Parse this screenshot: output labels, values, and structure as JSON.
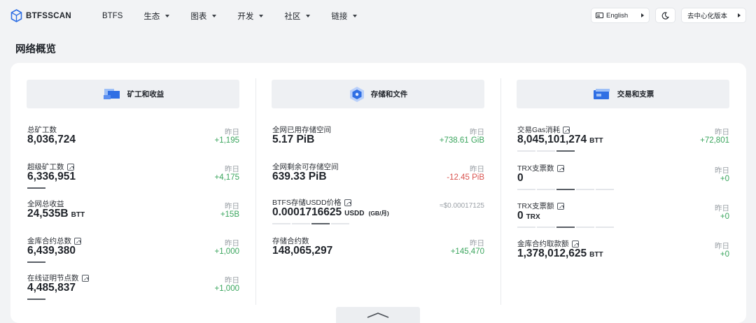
{
  "brand": {
    "name": "BTFSSCAN"
  },
  "nav": [
    {
      "label": "BTFS",
      "has_menu": false
    },
    {
      "label": "生态",
      "has_menu": true
    },
    {
      "label": "图表",
      "has_menu": true
    },
    {
      "label": "开发",
      "has_menu": true
    },
    {
      "label": "社区",
      "has_menu": true
    },
    {
      "label": "链接",
      "has_menu": true
    }
  ],
  "toolbar": {
    "language_label": "English",
    "decentralized_label": "去中心化版本"
  },
  "page_title": "网络概览",
  "yesterday_label": "昨日",
  "sections": {
    "mining": {
      "title": "矿工和收益",
      "stats": [
        {
          "label": "总矿工数",
          "value": "8,036,724",
          "delta": "+1,195"
        },
        {
          "label": "超级矿工数",
          "value": "6,336,951",
          "delta": "+4,175"
        },
        {
          "label": "全网总收益",
          "value": "24,535B",
          "unit": "BTT",
          "delta": "+15B"
        },
        {
          "label": "金库合约总数",
          "value": "6,439,380",
          "delta": "+1,000"
        },
        {
          "label": "在线证明节点数",
          "value": "4,485,837",
          "delta": "+1,000"
        }
      ]
    },
    "storage": {
      "title": "存储和文件",
      "stats": [
        {
          "label": "全网已用存储空间",
          "value": "5.17 PiB",
          "delta": "+738.61 GiB"
        },
        {
          "label": "全网剩余可存储空间",
          "value": "639.33 PiB",
          "delta": "-12.45 PiB"
        },
        {
          "label": "BTFS存储USDD价格",
          "value": "0.0001716625",
          "unit": "USDD",
          "subunit": "(GB/月)",
          "approx": "≈$0.00017125"
        },
        {
          "label": "存储合约数",
          "value": "148,065,297",
          "delta": "+145,470"
        }
      ]
    },
    "trading": {
      "title": "交易和支票",
      "stats": [
        {
          "label": "交易Gas消耗",
          "value": "8,045,101,274",
          "unit": "BTT",
          "delta": "+72,801"
        },
        {
          "label": "TRX支票数",
          "value": "0",
          "delta": "+0"
        },
        {
          "label": "TRX支票额",
          "value": "0",
          "unit": "TRX",
          "delta": "+0"
        },
        {
          "label": "金库合约取款额",
          "value": "1,378,012,625",
          "unit": "BTT",
          "delta": "+0"
        }
      ]
    }
  },
  "colors": {
    "positive": "#3aa55d",
    "negative": "#d9534f",
    "accent": "#2f6fe4"
  }
}
